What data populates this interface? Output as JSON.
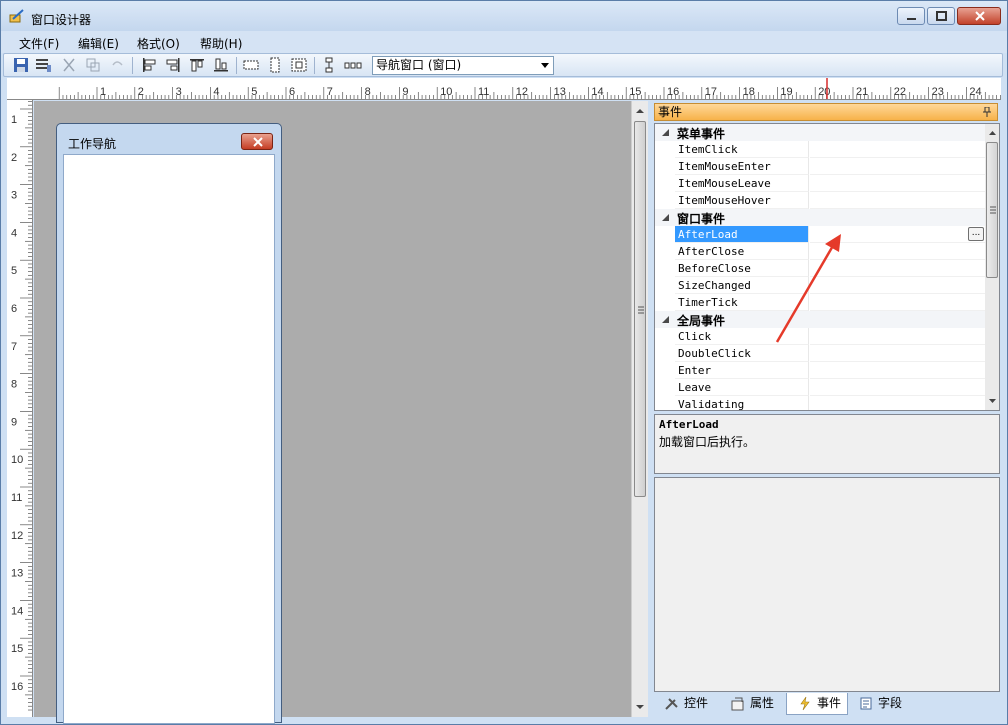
{
  "window": {
    "title": "窗口设计器"
  },
  "menu": [
    "文件(F)",
    "编辑(E)",
    "格式(O)",
    "帮助(H)"
  ],
  "toolbar": {
    "combo_value": "导航窗口 (窗口)"
  },
  "ruler": {
    "h_labels": [
      "1",
      "2",
      "3",
      "4",
      "5",
      "6",
      "7",
      "8",
      "9",
      "10",
      "11",
      "12",
      "13",
      "14",
      "15",
      "16",
      "17",
      "18",
      "19",
      "20",
      "21",
      "22",
      "23",
      "24"
    ],
    "v_labels": [
      "1",
      "2",
      "3",
      "4",
      "5",
      "6",
      "7",
      "8",
      "9",
      "10",
      "11",
      "12",
      "13",
      "14",
      "15",
      "16"
    ]
  },
  "design_form": {
    "title": "工作导航"
  },
  "panel": {
    "header": "事件"
  },
  "grid": {
    "menu_category": "菜单事件",
    "menu_events": [
      "ItemClick",
      "ItemMouseEnter",
      "ItemMouseLeave",
      "ItemMouseHover"
    ],
    "window_category": "窗口事件",
    "window_events": [
      "AfterLoad",
      "AfterClose",
      "BeforeClose",
      "SizeChanged",
      "TimerTick"
    ],
    "global_category": "全局事件",
    "global_events": [
      "Click",
      "DoubleClick",
      "Enter",
      "Leave",
      "Validating"
    ],
    "ellipsis": "..."
  },
  "description": {
    "title": "AfterLoad",
    "text": "加载窗口后执行。"
  },
  "tabs": [
    "控件",
    "属性",
    "事件",
    "字段"
  ],
  "colors": {
    "accent_orange": "#f7b24a",
    "selection_blue": "#3399ff",
    "annotation_red": "#e53a2a"
  }
}
